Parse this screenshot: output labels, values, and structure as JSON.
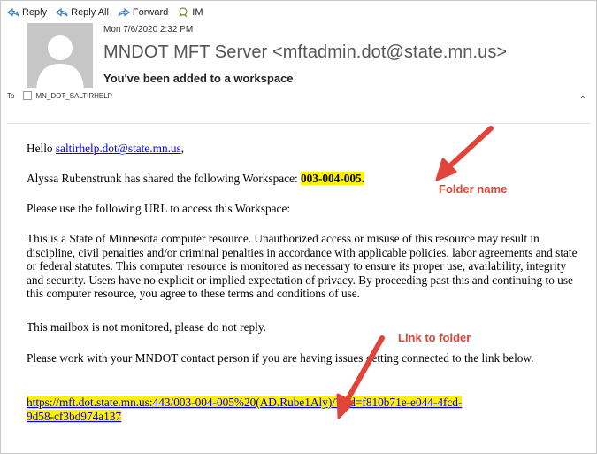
{
  "toolbar": {
    "reply": "Reply",
    "reply_all": "Reply All",
    "forward": "Forward",
    "im": "IM"
  },
  "header": {
    "date": "Mon 7/6/2020 2:32 PM",
    "sender": "MNDOT MFT Server <mftadmin.dot@state.mn.us>",
    "subject": "You've been added to a workspace",
    "to_label": "To",
    "to_value": "MN_DOT_SALTIRHELP"
  },
  "body": {
    "greeting_prefix": "Hello ",
    "greeting_email": "saltirhelp.dot@state.mn.us",
    "greeting_suffix": ",",
    "shared_prefix": "Alyssa Rubenstrunk has shared the following Workspace: ",
    "workspace": "003-004-005.",
    "url_instruction": "Please use the following URL to access this Workspace:",
    "disclaimer": "This is a State of Minnesota computer resource. Unauthorized access or misuse of this resource may result in discipline, civil penalties and/or criminal penalties in accordance with applicable policies, labor agreements and state or federal statutes. This computer resource is monitored as necessary to ensure its proper use, availability, integrity and security. Users have no explicit or implied expectation of privacy. By proceeding past this and continuing to use this computer resource, you agree to these terms and conditions of use.",
    "not_monitored": "This mailbox is not monitored, please do not reply.",
    "contact": "Please work with your MNDOT contact person if you are having issues getting connected to the link below.",
    "link_line1": "https://mft.dot.state.mn.us:443/003-004-005%20(AD.Rube1Aly)/?pid=f810b71e-e044-4fcd-",
    "link_line2": "9d58-cf3bd974a137"
  },
  "annotations": {
    "folder_name": "Folder name",
    "link_to_folder": "Link to folder",
    "color": "#e0443a"
  },
  "colors": {
    "highlight": "#fff200",
    "link": "#0000ee"
  }
}
